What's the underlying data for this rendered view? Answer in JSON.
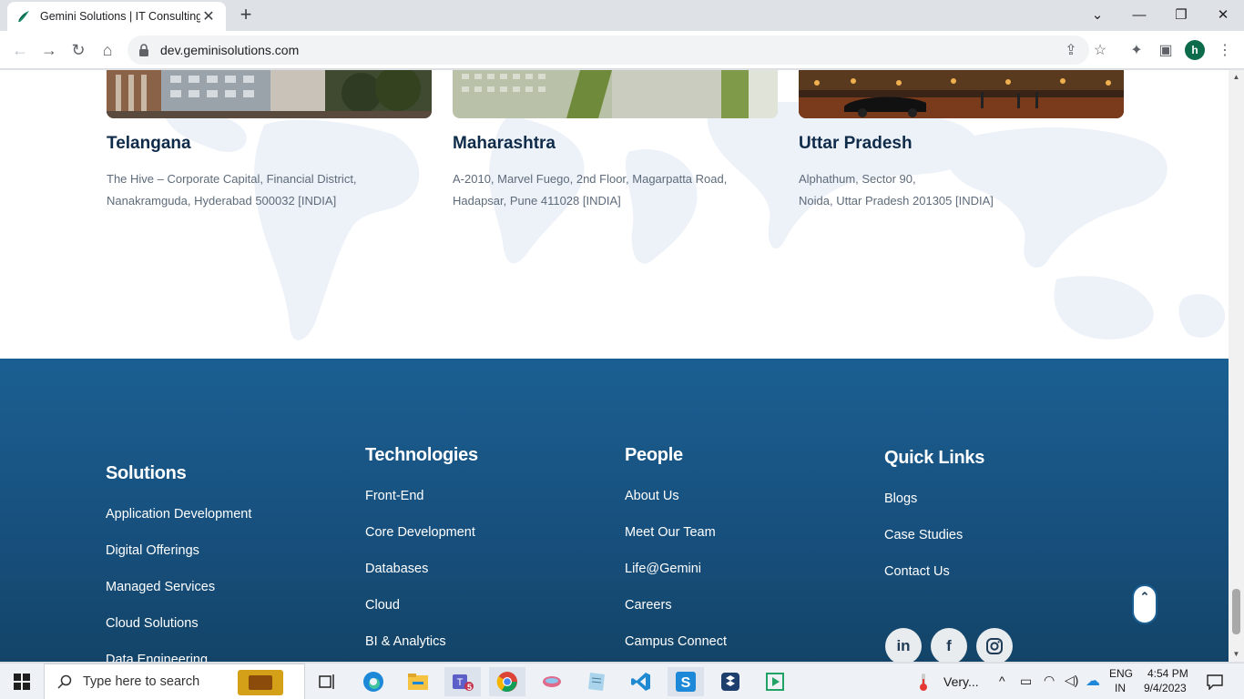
{
  "browser": {
    "tab_title": "Gemini Solutions | IT Consulting,",
    "url": "dev.geminisolutions.com",
    "profile_initial": "h"
  },
  "offices": [
    {
      "name": "Telangana",
      "address_line1": "The Hive – Corporate Capital, Financial District,",
      "address_line2": "Nanakramguda, Hyderabad 500032 [INDIA]"
    },
    {
      "name": "Maharashtra",
      "address_line1": "A-2010, Marvel Fuego, 2nd Floor, Magarpatta Road,",
      "address_line2": "Hadapsar, Pune 411028 [INDIA]"
    },
    {
      "name": "Uttar Pradesh",
      "address_line1": "Alphathum, Sector 90,",
      "address_line2": "Noida, Uttar Pradesh 201305 [INDIA]"
    }
  ],
  "footer": {
    "solutions": {
      "heading": "Solutions",
      "links": [
        "Application Development",
        "Digital Offerings",
        "Managed Services",
        "Cloud Solutions",
        "Data Engineering"
      ]
    },
    "technologies": {
      "heading": "Technologies",
      "links": [
        "Front-End",
        "Core Development",
        "Databases",
        "Cloud",
        "BI & Analytics"
      ]
    },
    "people": {
      "heading": "People",
      "links": [
        "About Us",
        "Meet Our Team",
        "Life@Gemini",
        "Careers",
        "Campus Connect"
      ]
    },
    "quick_links": {
      "heading": "Quick Links",
      "links": [
        "Blogs",
        "Case Studies",
        "Contact Us"
      ]
    },
    "social": [
      "linkedin-icon",
      "facebook-icon",
      "instagram-icon"
    ]
  },
  "taskbar": {
    "search_placeholder": "Type here to search",
    "weather": "Very...",
    "lang_top": "ENG",
    "lang_bottom": "IN",
    "time": "4:54 PM",
    "date": "9/4/2023",
    "teams_badge": "5"
  },
  "colors": {
    "footer_bg": "#1b5f92",
    "heading_dark": "#0f2b4a"
  }
}
